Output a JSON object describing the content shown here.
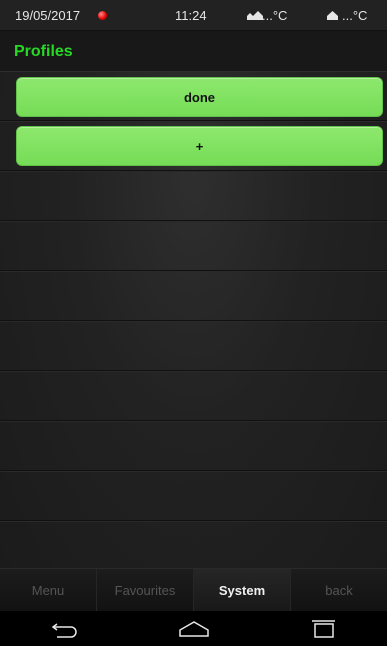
{
  "status_bar": {
    "date": "19/05/2017",
    "time": "11:24",
    "temp_outdoor": "...°C",
    "temp_indoor": "...°C",
    "recording_dot_color": "#e60000"
  },
  "header": {
    "title": "Profiles",
    "title_color": "#27d824"
  },
  "main": {
    "buttons": [
      {
        "label": "done"
      },
      {
        "label": "+"
      }
    ]
  },
  "bottom_nav": {
    "items": [
      {
        "label": "Menu",
        "active": false
      },
      {
        "label": "Favourites",
        "active": false
      },
      {
        "label": "System",
        "active": true
      },
      {
        "label": "back",
        "active": false
      }
    ]
  },
  "android_nav": {
    "icons": [
      "back-arrow-icon",
      "home-icon",
      "recent-apps-icon"
    ]
  },
  "colors": {
    "accent_green": "#7de25f",
    "background": "#1b1b1b"
  }
}
